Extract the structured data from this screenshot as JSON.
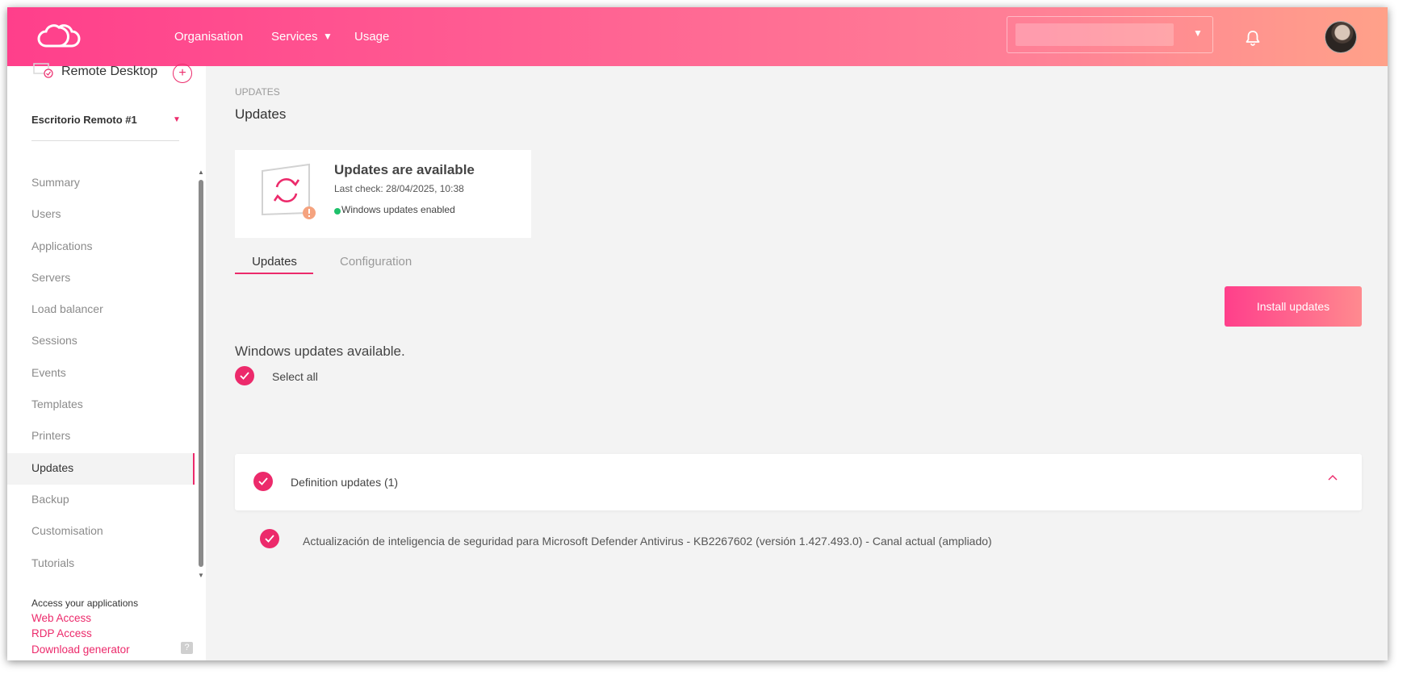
{
  "topbar": {
    "nav": [
      {
        "label": "Organisation"
      },
      {
        "label": "Services"
      },
      {
        "label": "Usage"
      }
    ]
  },
  "sidebar": {
    "app_title": "Remote Desktop",
    "desktop_name": "Escritorio Remoto #1",
    "items": [
      {
        "label": "Summary"
      },
      {
        "label": "Users"
      },
      {
        "label": "Applications"
      },
      {
        "label": "Servers"
      },
      {
        "label": "Load balancer"
      },
      {
        "label": "Sessions"
      },
      {
        "label": "Events"
      },
      {
        "label": "Templates"
      },
      {
        "label": "Printers"
      },
      {
        "label": "Updates"
      },
      {
        "label": "Backup"
      },
      {
        "label": "Customisation"
      },
      {
        "label": "Tutorials"
      }
    ],
    "active_item": "Updates",
    "access_label": "Access your applications",
    "links": {
      "web": "Web Access",
      "rdp": "RDP Access",
      "download": "Download generator"
    },
    "help": "?"
  },
  "main": {
    "breadcrumb": "UPDATES",
    "title": "Updates",
    "status": {
      "title": "Updates are available",
      "last_check": "Last check: 28/04/2025, 10:38",
      "enabled_text": "Windows updates enabled",
      "enabled_color": "#1fc16b"
    },
    "tabs": [
      {
        "label": "Updates"
      },
      {
        "label": "Configuration"
      }
    ],
    "active_tab": "Updates",
    "install_button": "Install updates",
    "section_title": "Windows updates available.",
    "select_all": "Select all",
    "groups": [
      {
        "label": "Definition updates (1)",
        "updates": [
          {
            "label": "Actualización de inteligencia de seguridad para Microsoft Defender Antivirus - KB2267602 (versión 1.427.493.0) - Canal actual (ampliado)"
          }
        ]
      }
    ]
  },
  "colors": {
    "accent": "#ec2a6b",
    "gradient_start": "#ff3f8b",
    "gradient_end": "#ffa189"
  }
}
